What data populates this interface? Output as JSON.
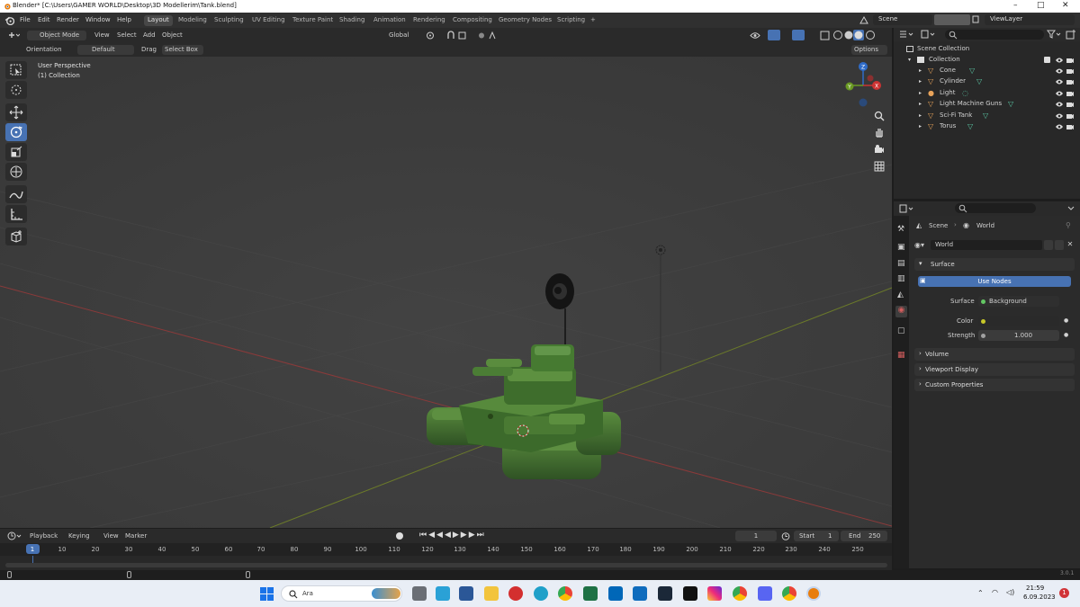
{
  "window": {
    "title": "Blender* [C:\\Users\\GAMER WORLD\\Desktop\\3D Modellerim\\Tank.blend]",
    "controls": [
      "–",
      "□",
      "✕"
    ]
  },
  "menu": [
    "File",
    "Edit",
    "Render",
    "Window",
    "Help"
  ],
  "workspaces": [
    "Layout",
    "Modeling",
    "Sculpting",
    "UV Editing",
    "Texture Paint",
    "Shading",
    "Animation",
    "Rendering",
    "Compositing",
    "Geometry Nodes",
    "Scripting",
    "+"
  ],
  "active_workspace": "Layout",
  "scene_name": "Scene",
  "view_layer": "ViewLayer",
  "viewport_header": {
    "mode": "Object Mode",
    "menus": [
      "View",
      "Select",
      "Add",
      "Object"
    ],
    "transform": "Global",
    "orientation_label": "Orientation",
    "orientation_value": "Default",
    "drag_label": "Drag",
    "drag_value": "Select Box",
    "options": "Options"
  },
  "viewport": {
    "view_name": "User Perspective",
    "collection_info": "(1) Collection",
    "gizmo": {
      "z": "Z",
      "y": "Y",
      "x": "X"
    }
  },
  "outliner": {
    "root": "Scene Collection",
    "collection": "Collection",
    "objects": [
      "Cone",
      "Cylinder",
      "Light",
      "Light Machine Guns",
      "Sci-Fi Tank",
      "Torus"
    ]
  },
  "properties": {
    "breadcrumb_scene": "Scene",
    "breadcrumb_world": "World",
    "world_field": "World",
    "surface_panel": "Surface",
    "use_nodes": "Use Nodes",
    "surface_label": "Surface",
    "surface_value": "Background",
    "color_label": "Color",
    "strength_label": "Strength",
    "strength_value": "1.000",
    "volume_panel": "Volume",
    "viewport_display_panel": "Viewport Display",
    "custom_props_panel": "Custom Properties"
  },
  "timeline": {
    "menus": [
      "Playback",
      "Keying",
      "View",
      "Marker"
    ],
    "current_frame": "1",
    "start_label": "Start",
    "start_value": "1",
    "end_label": "End",
    "end_value": "250",
    "ruler": [
      "1",
      "10",
      "20",
      "30",
      "40",
      "50",
      "60",
      "70",
      "80",
      "90",
      "100",
      "110",
      "120",
      "130",
      "140",
      "150",
      "160",
      "170",
      "180",
      "190",
      "200",
      "210",
      "220",
      "230",
      "240",
      "250"
    ]
  },
  "status_version": "3.0.1",
  "taskbar": {
    "search_placeholder": "Ara",
    "time": "21:59",
    "date": "6.09.2023",
    "notification_count": "1"
  },
  "colors": {
    "accent_blue": "#4772b3",
    "tank_green": "#3f6b2e",
    "grid_red": "#8a3a3a",
    "grid_green": "#6b7a2a"
  }
}
